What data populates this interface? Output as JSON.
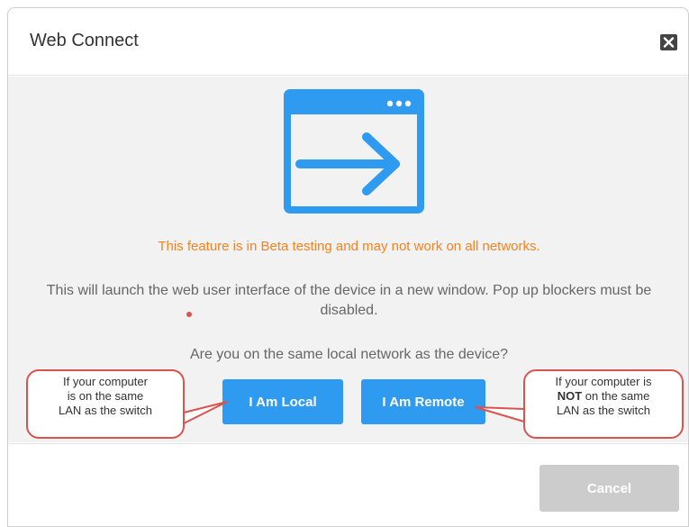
{
  "dialog": {
    "title": "Web Connect",
    "beta_notice": "This feature is in Beta testing and may not work on all networks.",
    "description": "This will launch the web user interface of the device in a new window. Pop up blockers must be disabled.",
    "question": "Are you on the same local network as the device?",
    "local_button": "I Am Local",
    "remote_button": "I Am Remote",
    "cancel_button": "Cancel"
  },
  "callouts": {
    "local": {
      "line1": "If your computer",
      "line2": "is on the same",
      "line3": "LAN as the switch"
    },
    "remote": {
      "line1": "If your computer is",
      "line2_bold": "NOT",
      "line2_rest": " on the same",
      "line3": "LAN as the switch"
    }
  },
  "icons": {
    "close": "close-icon",
    "window": "browser-window-arrow-icon"
  },
  "colors": {
    "accent_blue": "#2f9bf0",
    "beta_orange": "#f5821f",
    "callout_red": "#d9534f",
    "disabled_gray": "#cccccc"
  }
}
